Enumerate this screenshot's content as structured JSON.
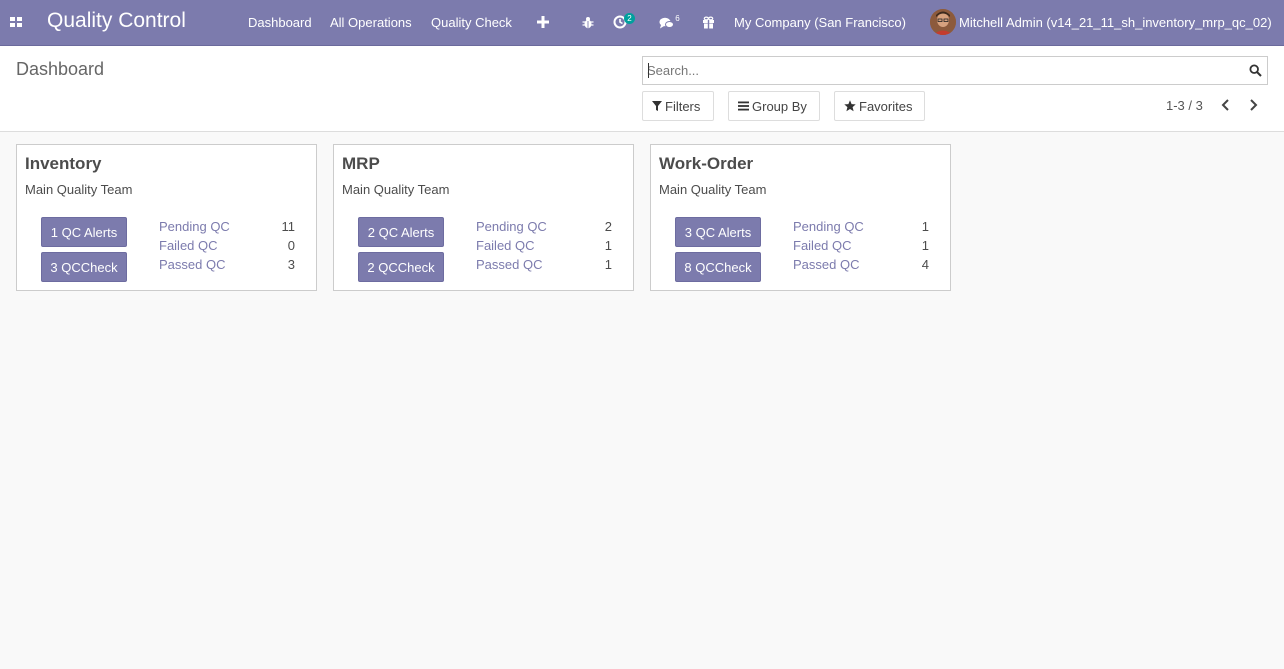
{
  "app": {
    "title": "Quality Control"
  },
  "nav": {
    "menu": [
      "Dashboard",
      "All Operations",
      "Quality Check"
    ],
    "icons": {
      "apps": "apps-grid-icon",
      "plus": "plus-icon",
      "debug": "bug-icon",
      "activity": "clock-icon",
      "messages": "chat-icon",
      "gift": "gift-icon"
    },
    "activity_count": "2",
    "messages_count": "6",
    "company": "My Company (San Francisco)",
    "user": "Mitchell Admin (v14_21_11_sh_inventory_mrp_qc_02)"
  },
  "control_panel": {
    "breadcrumb": "Dashboard",
    "search_placeholder": "Search...",
    "filters_label": "Filters",
    "groupby_label": "Group By",
    "favorites_label": "Favorites",
    "pager": "1-3 / 3"
  },
  "cards": [
    {
      "title": "Inventory",
      "team": "Main Quality Team",
      "alerts_button": "1 QC Alerts",
      "check_button": "3 QCCheck",
      "stats": [
        {
          "label": "Pending QC",
          "value": "11"
        },
        {
          "label": "Failed QC",
          "value": "0"
        },
        {
          "label": "Passed QC",
          "value": "3"
        }
      ]
    },
    {
      "title": "MRP",
      "team": "Main Quality Team",
      "alerts_button": "2 QC Alerts",
      "check_button": "2 QCCheck",
      "stats": [
        {
          "label": "Pending QC",
          "value": "2"
        },
        {
          "label": "Failed QC",
          "value": "1"
        },
        {
          "label": "Passed QC",
          "value": "1"
        }
      ]
    },
    {
      "title": "Work-Order",
      "team": "Main Quality Team",
      "alerts_button": "3 QC Alerts",
      "check_button": "8 QCCheck",
      "stats": [
        {
          "label": "Pending QC",
          "value": "1"
        },
        {
          "label": "Failed QC",
          "value": "1"
        },
        {
          "label": "Passed QC",
          "value": "4"
        }
      ]
    }
  ],
  "colors": {
    "brand": "#7c7bad",
    "badge": "#00a09d",
    "background": "#f9f9f9"
  }
}
